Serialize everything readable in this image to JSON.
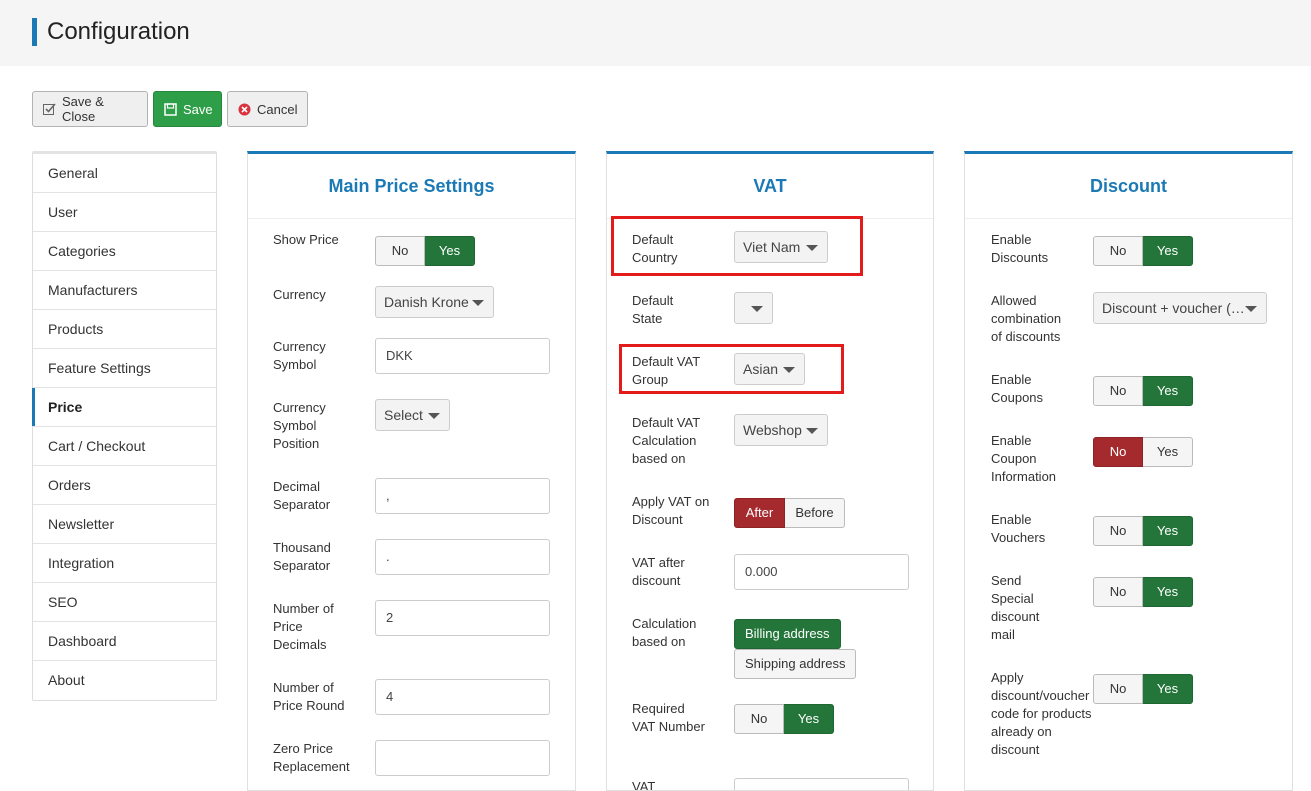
{
  "header": {
    "title": "Configuration"
  },
  "toolbar": {
    "save_close": "Save & Close",
    "save": "Save",
    "cancel": "Cancel"
  },
  "sidebar": {
    "items": [
      "General",
      "User",
      "Categories",
      "Manufacturers",
      "Products",
      "Feature Settings",
      "Price",
      "Cart / Checkout",
      "Orders",
      "Newsletter",
      "Integration",
      "SEO",
      "Dashboard",
      "About"
    ],
    "active": "Price"
  },
  "main_price": {
    "title": "Main Price Settings",
    "show_price": {
      "label": "Show Price",
      "no": "No",
      "yes": "Yes",
      "value": "Yes"
    },
    "currency": {
      "label": "Currency",
      "value": "Danish Krone"
    },
    "currency_symbol": {
      "label": "Currency Symbol",
      "value": "DKK"
    },
    "currency_symbol_position": {
      "label": "Currency Symbol Position",
      "value": "Select"
    },
    "decimal_separator": {
      "label": "Decimal Separator",
      "value": ","
    },
    "thousand_separator": {
      "label": "Thousand Separator",
      "value": "."
    },
    "price_decimals": {
      "label": "Number of Price Decimals",
      "value": "2"
    },
    "price_round": {
      "label": "Number of Price Round",
      "value": "4"
    },
    "zero_price": {
      "label": "Zero Price Replacement",
      "value": ""
    }
  },
  "vat": {
    "title": "VAT",
    "default_country": {
      "label": "Default Country",
      "value": "Viet Nam"
    },
    "default_state": {
      "label": "Default State",
      "value": ""
    },
    "default_vat_group": {
      "label": "Default VAT Group",
      "value": "Asian"
    },
    "calc_based": {
      "label": "Default VAT Calculation based on",
      "value": "Webshop"
    },
    "apply_on_discount": {
      "label": "Apply VAT on Discount",
      "after": "After",
      "before": "Before",
      "value": "After"
    },
    "vat_after_discount": {
      "label": "VAT after discount",
      "value": "0.000"
    },
    "calculation_based_on": {
      "label": "Calculation based on",
      "billing": "Billing address",
      "shipping": "Shipping address",
      "value": "Billing address"
    },
    "required_vat_number": {
      "label": "Required VAT Number",
      "no": "No",
      "yes": "Yes",
      "value": "Yes"
    },
    "cut_label": "VAT"
  },
  "discount": {
    "title": "Discount",
    "enable_discounts": {
      "label": "Enable Discounts",
      "no": "No",
      "yes": "Yes",
      "value": "Yes"
    },
    "allowed_combination": {
      "label": "Allowed combination of discounts",
      "value": "Discount + voucher (…"
    },
    "enable_coupons": {
      "label": "Enable Coupons",
      "no": "No",
      "yes": "Yes",
      "value": "Yes"
    },
    "enable_coupon_info": {
      "label": "Enable Coupon Information",
      "no": "No",
      "yes": "Yes",
      "value": "No"
    },
    "enable_vouchers": {
      "label": "Enable Vouchers",
      "no": "No",
      "yes": "Yes",
      "value": "Yes"
    },
    "special_discount_mail": {
      "label": "Send Special discount mail",
      "no": "No",
      "yes": "Yes",
      "value": "Yes"
    },
    "apply_code": {
      "label": "Apply discount/voucher code for products already on discount",
      "no": "No",
      "yes": "Yes",
      "value": "Yes"
    }
  },
  "colors": {
    "accent": "#1b7ab5",
    "green": "#24753a",
    "red": "#a42a2e",
    "highlight": "#e31b1b"
  }
}
